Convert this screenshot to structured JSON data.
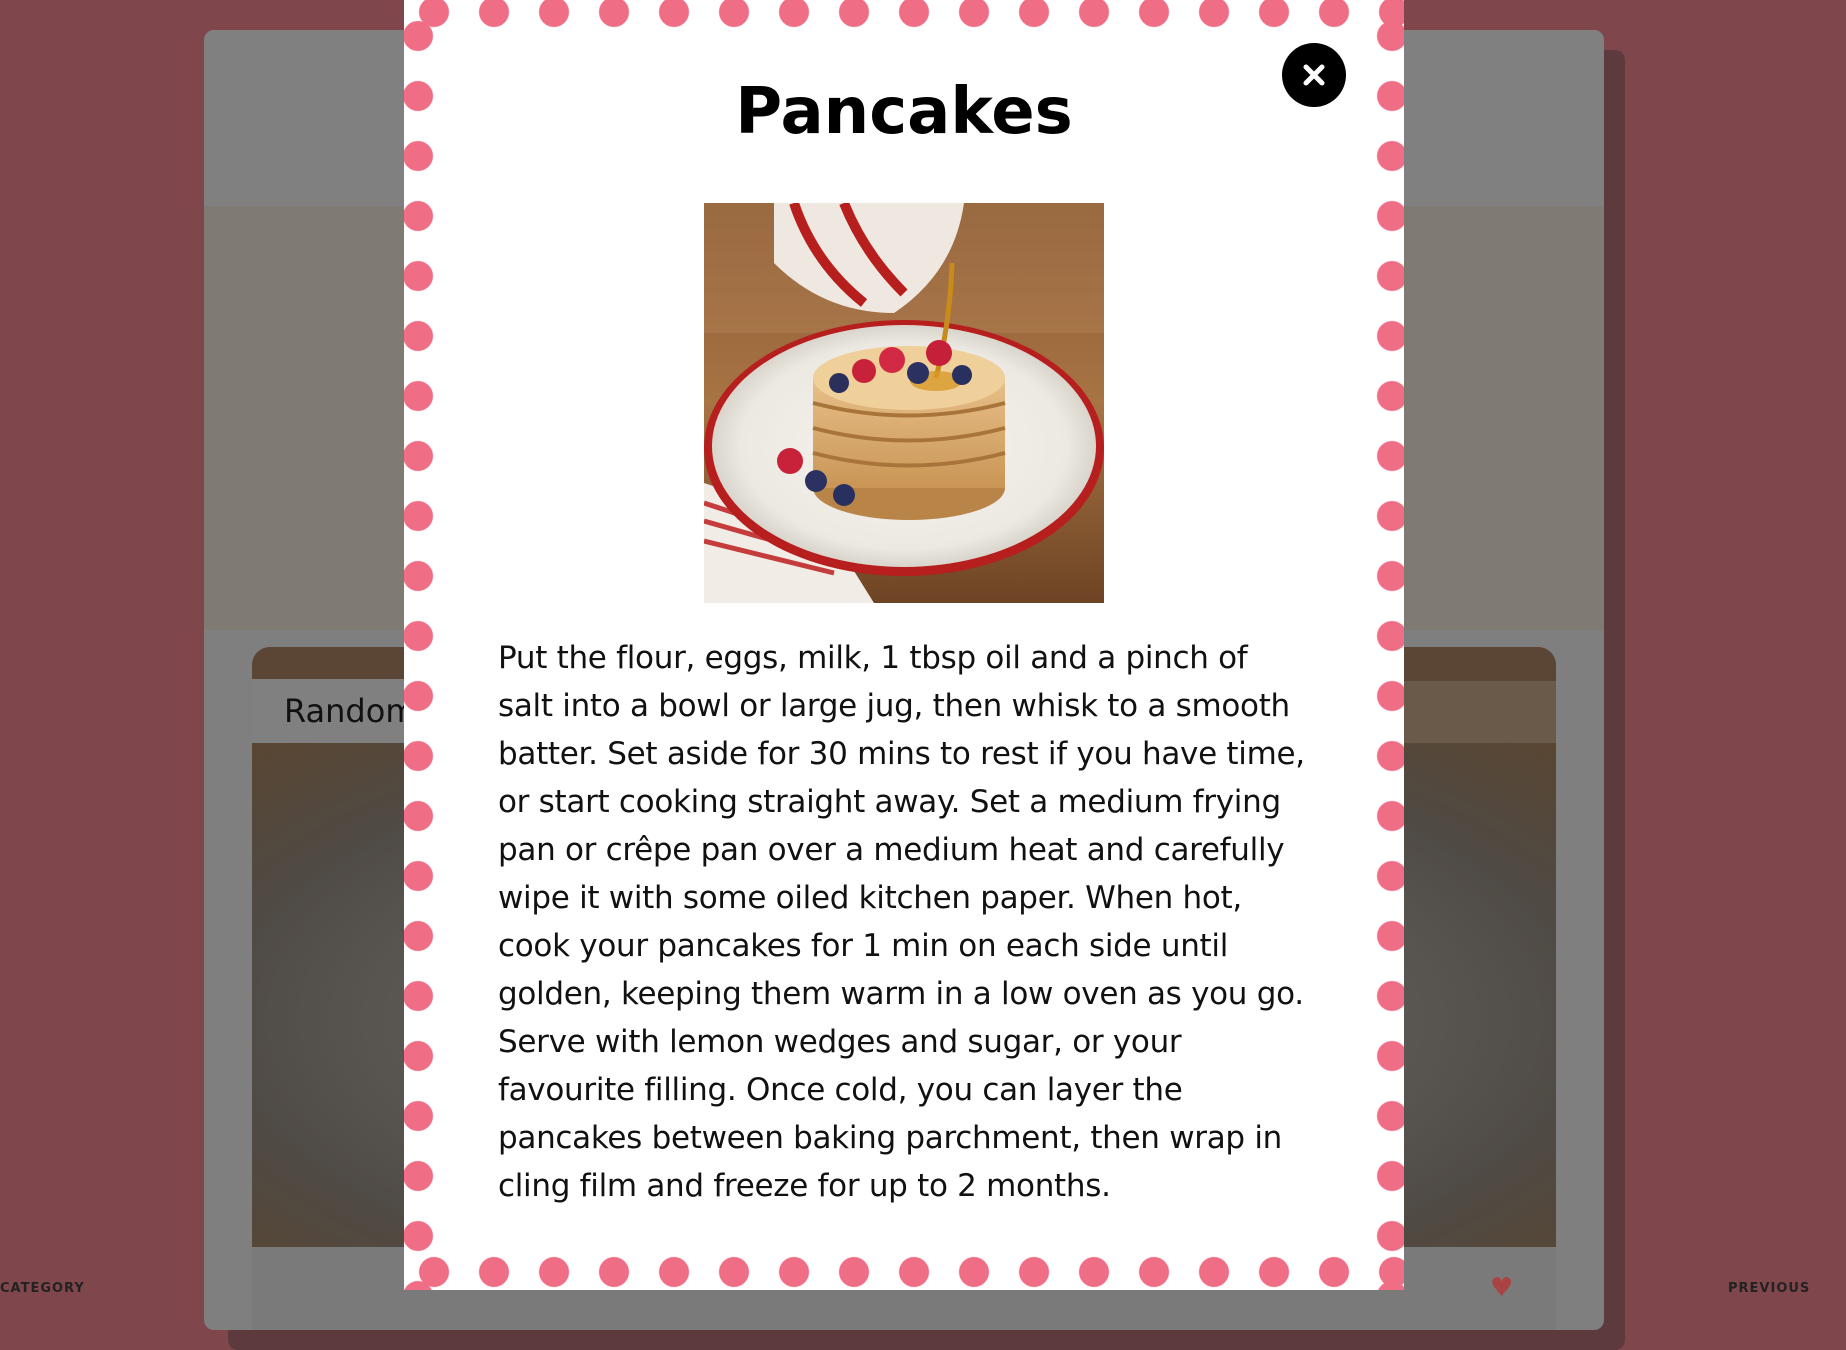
{
  "background": {
    "random_tag_label": "Random",
    "bottom_left_text": "CATEGORY",
    "bottom_right_text": "PREVIOUS"
  },
  "modal": {
    "title": "Pancakes",
    "photo_alt": "Pancakes",
    "instructions": "Put the flour, eggs, milk, 1 tbsp oil and a pinch of salt into a bowl or large jug, then whisk to a smooth batter. Set aside for 30 mins to rest if you have time, or start cooking straight away. Set a medium frying pan or crêpe pan over a medium heat and carefully wipe it with some oiled kitchen paper. When hot, cook your pancakes for 1 min on each side until golden, keeping them warm in a low oven as you go. Serve with lemon wedges and sugar, or your favourite filling. Once cold, you can layer the pancakes between baking parchment, then wrap in cling film and freeze for up to 2 months.",
    "close_icon": "close-icon"
  },
  "colors": {
    "overlay": "#7f474c",
    "polka_dot": "#ef6e86",
    "modal_bg": "#ffffff",
    "close_button": "#000000"
  }
}
